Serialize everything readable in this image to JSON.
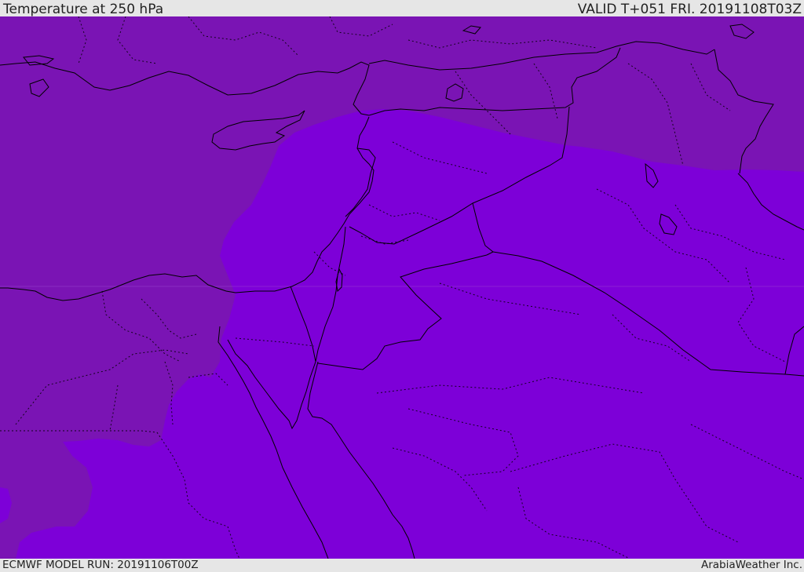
{
  "header": {
    "title": "Temperature at 250 hPa",
    "valid_time": "VALID T+051 FRI. 20191108T03Z"
  },
  "footer": {
    "model_run": "ECMWF MODEL RUN: 20191106T00Z",
    "credit": "ArabiaWeather Inc."
  },
  "map": {
    "colors": {
      "warmer_band": "#7a14b4",
      "colder_band": "#7d00d8",
      "borders": "#000000"
    }
  }
}
